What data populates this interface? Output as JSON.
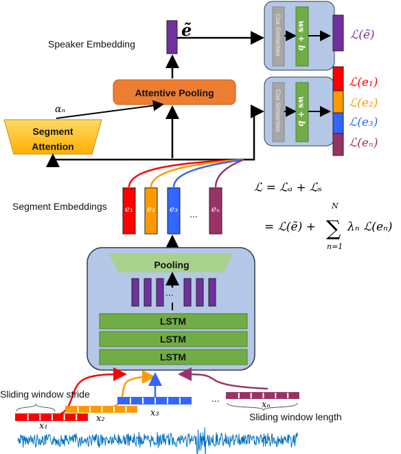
{
  "speaker_embedding_label": "Speaker Embedding",
  "speaker_embedding_symbol": "ẽ",
  "attentive_pooling_label": "Attentive Pooling",
  "segment_attention_label": [
    "Segment",
    "Attention"
  ],
  "alpha_label": "αₙ",
  "segment_embeddings_label": "Segment Embeddings",
  "segment_embeddings": [
    {
      "label": "e₁",
      "color": "#ff0000"
    },
    {
      "label": "e₂",
      "color": "#ff9900"
    },
    {
      "label": "e₃",
      "color": "#3366ff"
    },
    {
      "label": "eₙ",
      "color": "#993366"
    }
  ],
  "ellipsis": "...",
  "classifier": {
    "cos_label": "Cos Similarities",
    "linear_label": "ws + b"
  },
  "losses": {
    "speaker": {
      "label": "ℒ(ẽ)",
      "color": "#7030a0"
    },
    "segments": [
      {
        "label": "ℒ(e₁)",
        "color": "#ff0000"
      },
      {
        "label": "ℒ(e₂)",
        "color": "#ff9900"
      },
      {
        "label": "ℒ(e₃)",
        "color": "#3366ff"
      },
      {
        "label": "ℒ(eₙ)",
        "color": "#993366"
      }
    ]
  },
  "formula": {
    "line1": "ℒ = ℒₐ + ℒₛ",
    "line2_left": "= ℒ(ẽ) +",
    "sum": "∑",
    "sum_top": "N",
    "sum_bottom": "n=1",
    "line2_right": "λₙ ℒ(eₙ)"
  },
  "pooling_label": "Pooling",
  "lstm_labels": [
    "LSTM",
    "LSTM",
    "LSTM"
  ],
  "windows": [
    {
      "label": "x₁",
      "color": "#ff0000"
    },
    {
      "label": "x₂",
      "color": "#ff9900"
    },
    {
      "label": "x₃",
      "color": "#3366ff"
    },
    {
      "label": "xₙ",
      "color": "#993366"
    }
  ],
  "sliding_stride_label": "Sliding window stride",
  "sliding_length_label": "Sliding window length",
  "colors": {
    "box_blue": "#b4c7e7",
    "orange": "#ed7d31",
    "gold": "#ffc000",
    "lstm_green": "#70ad47",
    "pool_green": "#a9d18e",
    "purple": "#7030a0",
    "wave": "#0070c0"
  }
}
